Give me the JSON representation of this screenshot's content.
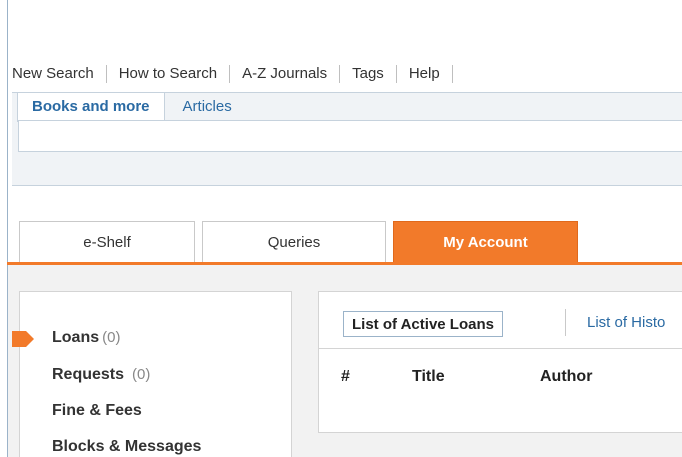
{
  "topnav": {
    "items": [
      "New Search",
      "How to Search",
      "A-Z Journals",
      "Tags",
      "Help"
    ]
  },
  "search": {
    "tabs": [
      "Books and more",
      "Articles"
    ],
    "active_tab": "Books and more"
  },
  "account_tabs": {
    "eshelf": "e-Shelf",
    "queries": "Queries",
    "my_account": "My Account"
  },
  "sidebar": {
    "items": [
      {
        "label": "Loans",
        "count": "(0)"
      },
      {
        "label": "Requests",
        "count": "(0)"
      },
      {
        "label": "Fine & Fees",
        "count": ""
      },
      {
        "label": "Blocks & Messages",
        "count": ""
      }
    ]
  },
  "loans": {
    "active_tab": "List of Active Loans",
    "history_tab": "List of Histo",
    "columns": [
      "#",
      "Title",
      "Author"
    ]
  },
  "colors": {
    "accent": "#f27a2a",
    "link": "#2a6aa3"
  }
}
